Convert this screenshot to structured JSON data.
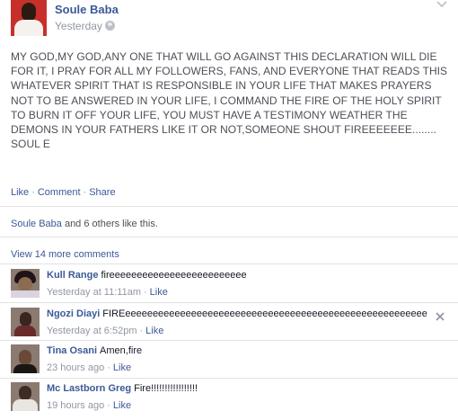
{
  "post": {
    "author": "Soule Baba",
    "time": "Yesterday",
    "privacy_icon": "globe-icon",
    "body_lines": [
      "MY GOD,MY GOD,ANY ONE THAT WILL GO AGAINST THIS DECLARATION WILL DIE",
      "FOR IT, I PRAY FOR ALL MY FOLLOWERS, FANS, AND EVERYONE THAT READS THIS",
      "WHATEVER SPIRIT THAT IS RESPONSIBLE IN YOUR LIFE THAT MAKES PRAYERS",
      "NOT TO BE ANSWERED IN YOUR LIFE, I COMMAND THE FIRE OF THE HOLY SPIRIT",
      "TO BURN IT OFF YOUR LIFE, YOU MUST HAVE A TESTIMONY WEATHER THE",
      "DEMONS IN YOUR FATHERS LIKE IT OR NOT,SOMEONE SHOUT FIREEEEEEE........",
      "SOUL E"
    ],
    "actions": {
      "like": "Like",
      "comment": "Comment",
      "share": "Share"
    }
  },
  "likes": {
    "name": "Soule Baba",
    "rest": " and 6 others like this."
  },
  "view_more": "View 14 more comments",
  "comments": [
    {
      "name": "Kull Range",
      "text": "fireeeeeeeeeeeeeeeeeeeeeeeee",
      "time": "Yesterday at 11:11am",
      "like": "Like"
    },
    {
      "name": "Ngozi Diayi",
      "text": "FIREeeeeeeeeeeeeeeeeeeeeeeeeeeeeeeeeeeeeeeeeeeeeeeeeeeeeeee",
      "time": "Yesterday at 6:52pm",
      "like": "Like"
    },
    {
      "name": "Tina Osani",
      "text": "Amen,fire",
      "time": "23 hours ago",
      "like": "Like"
    },
    {
      "name": "Mc Lastborn Greg",
      "text": "Fire!!!!!!!!!!!!!!!!!",
      "time": "19 hours ago",
      "like": "Like"
    }
  ],
  "separator": "·",
  "colors": {
    "link": "#3b5998",
    "meta": "#9197a3",
    "body": "#4b4f56"
  }
}
